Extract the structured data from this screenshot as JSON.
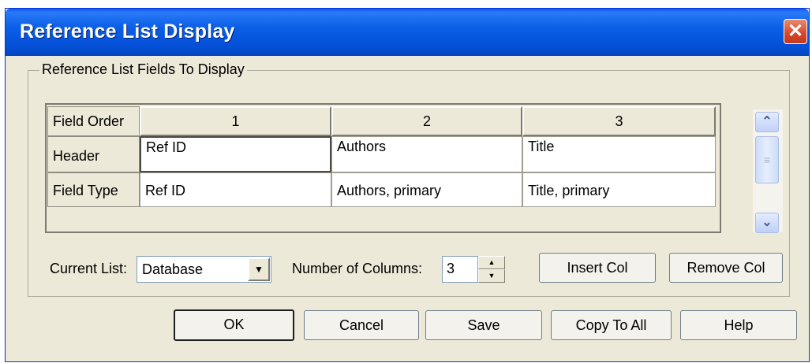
{
  "window": {
    "title": "Reference List Display",
    "close_glyph": "✕"
  },
  "group": {
    "label": "Reference List Fields To Display"
  },
  "grid": {
    "rows": [
      {
        "label": "Field Order",
        "cells": [
          "1",
          "2",
          "3"
        ]
      },
      {
        "label": "Header",
        "cells": [
          "Ref ID",
          "Authors",
          "Title"
        ]
      },
      {
        "label": "Field Type",
        "cells": [
          "Ref ID",
          "Authors, primary",
          "Title, primary"
        ]
      }
    ]
  },
  "scrollbar": {
    "up_icon": "chevron-up-icon",
    "down_icon": "chevron-down-icon"
  },
  "controls": {
    "current_list_label": "Current List:",
    "current_list_value": "Database",
    "num_columns_label": "Number of Columns:",
    "num_columns_value": "3",
    "insert_col": "Insert Col",
    "remove_col": "Remove Col"
  },
  "buttons": {
    "ok": "OK",
    "cancel": "Cancel",
    "save": "Save",
    "copy_to_all": "Copy To All",
    "help": "Help"
  },
  "colors": {
    "title_bar": "#0a5fe6",
    "dialog_bg": "#ece9d8",
    "close_button": "#d6462a"
  }
}
